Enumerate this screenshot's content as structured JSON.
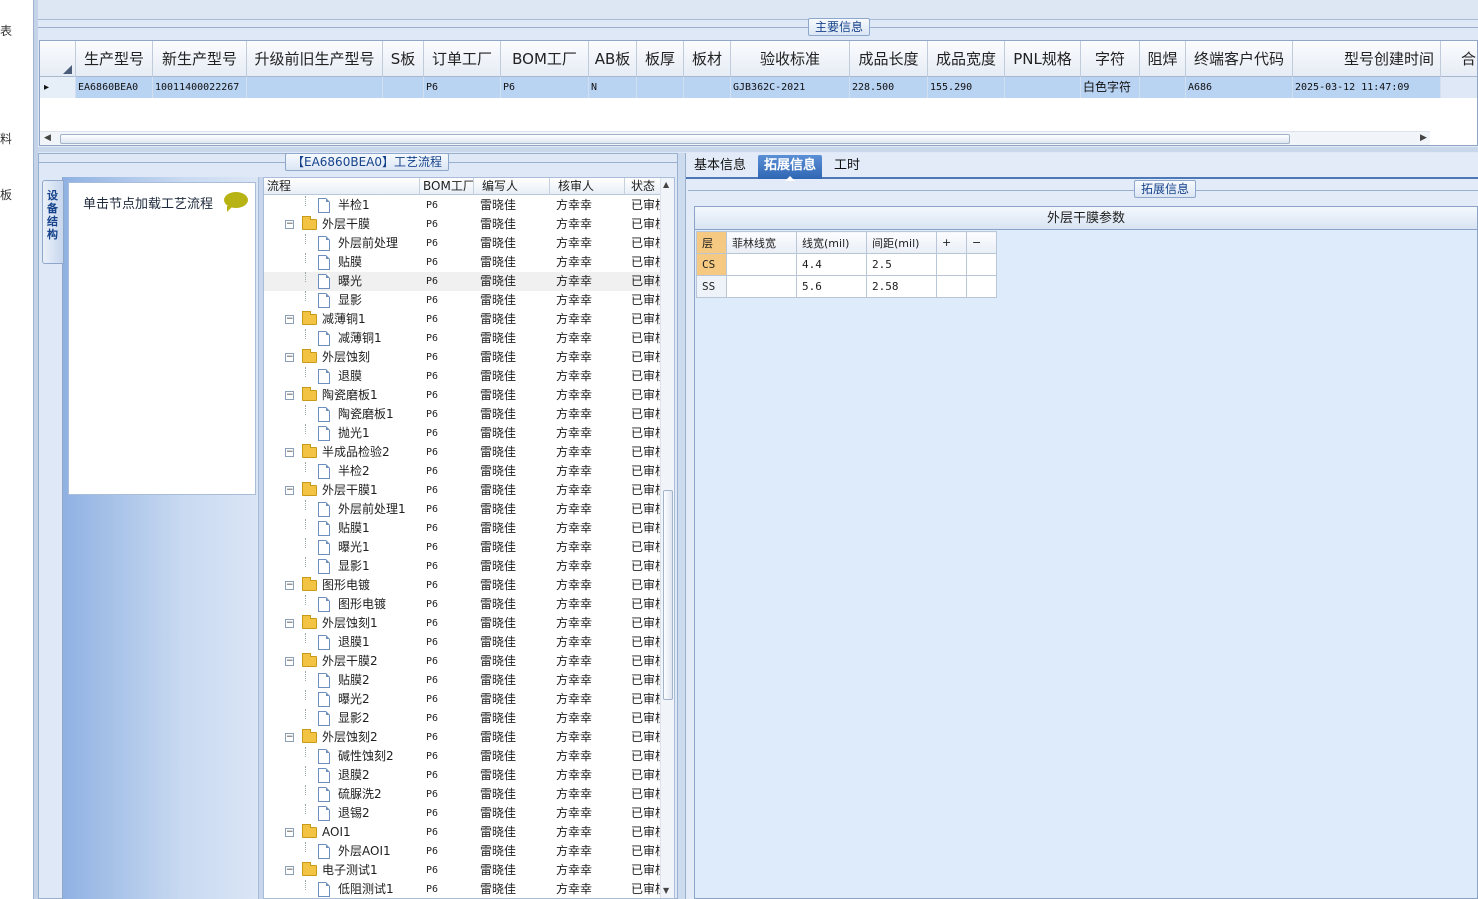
{
  "left_strip": {
    "glyphs": [
      "表",
      "料",
      "板"
    ]
  },
  "main_info": {
    "group_title": "主要信息",
    "columns": [
      "生产型号",
      "新生产型号",
      "升级前旧生产型号",
      "S板",
      "订单工厂",
      "BOM工厂",
      "AB板",
      "板厚",
      "板材",
      "验收标准",
      "成品长度",
      "成品宽度",
      "PNL规格",
      "字符",
      "阻焊",
      "终端客户代码",
      "型号创建时间",
      "合"
    ],
    "row": {
      "selector": "▸",
      "prod_model": "EA6860BEA0",
      "new_model": "10011400022267",
      "old_model": "",
      "s_board": "",
      "order_factory": "P6",
      "bom_factory": "P6",
      "ab_board": "N",
      "thickness": "",
      "material": "",
      "standard": "GJB362C-2021",
      "length": "228.500",
      "width": "155.290",
      "pnl": "",
      "char": "白色字符",
      "solder": "",
      "customer_code": "A686",
      "create_time": "2025-03-12 11:47:09"
    }
  },
  "process": {
    "group_title": "【EA6860BEA0】工艺流程",
    "side_tab": "设备结构",
    "hint": "单击节点加载工艺流程",
    "headers": [
      "流程",
      "BOM工厂",
      "编写人",
      "核审人",
      "状态"
    ],
    "rows": [
      {
        "name": "半检1",
        "level": 2,
        "type": "doc",
        "factory": "P6",
        "writer": "雷晓佳",
        "reviewer": "方幸幸",
        "status": "已审核"
      },
      {
        "name": "外层干膜",
        "level": 1,
        "type": "folder",
        "factory": "P6",
        "writer": "雷晓佳",
        "reviewer": "方幸幸",
        "status": "已审核"
      },
      {
        "name": "外层前处理",
        "level": 2,
        "type": "doc",
        "factory": "P6",
        "writer": "雷晓佳",
        "reviewer": "方幸幸",
        "status": "已审核"
      },
      {
        "name": "贴膜",
        "level": 2,
        "type": "doc",
        "factory": "P6",
        "writer": "雷晓佳",
        "reviewer": "方幸幸",
        "status": "已审核"
      },
      {
        "name": "曝光",
        "level": 2,
        "type": "doc",
        "factory": "P6",
        "writer": "雷晓佳",
        "reviewer": "方幸幸",
        "status": "已审核",
        "highlight": true
      },
      {
        "name": "显影",
        "level": 2,
        "type": "doc",
        "factory": "P6",
        "writer": "雷晓佳",
        "reviewer": "方幸幸",
        "status": "已审核"
      },
      {
        "name": "减薄铜1",
        "level": 1,
        "type": "folder",
        "factory": "P6",
        "writer": "雷晓佳",
        "reviewer": "方幸幸",
        "status": "已审核"
      },
      {
        "name": "减薄铜1",
        "level": 2,
        "type": "doc",
        "factory": "P6",
        "writer": "雷晓佳",
        "reviewer": "方幸幸",
        "status": "已审核"
      },
      {
        "name": "外层蚀刻",
        "level": 1,
        "type": "folder",
        "factory": "P6",
        "writer": "雷晓佳",
        "reviewer": "方幸幸",
        "status": "已审核"
      },
      {
        "name": "退膜",
        "level": 2,
        "type": "doc",
        "factory": "P6",
        "writer": "雷晓佳",
        "reviewer": "方幸幸",
        "status": "已审核"
      },
      {
        "name": "陶瓷磨板1",
        "level": 1,
        "type": "folder",
        "factory": "P6",
        "writer": "雷晓佳",
        "reviewer": "方幸幸",
        "status": "已审核"
      },
      {
        "name": "陶瓷磨板1",
        "level": 2,
        "type": "doc",
        "factory": "P6",
        "writer": "雷晓佳",
        "reviewer": "方幸幸",
        "status": "已审核"
      },
      {
        "name": "抛光1",
        "level": 2,
        "type": "doc",
        "factory": "P6",
        "writer": "雷晓佳",
        "reviewer": "方幸幸",
        "status": "已审核"
      },
      {
        "name": "半成品检验2",
        "level": 1,
        "type": "folder",
        "factory": "P6",
        "writer": "雷晓佳",
        "reviewer": "方幸幸",
        "status": "已审核"
      },
      {
        "name": "半检2",
        "level": 2,
        "type": "doc",
        "factory": "P6",
        "writer": "雷晓佳",
        "reviewer": "方幸幸",
        "status": "已审核"
      },
      {
        "name": "外层干膜1",
        "level": 1,
        "type": "folder",
        "factory": "P6",
        "writer": "雷晓佳",
        "reviewer": "方幸幸",
        "status": "已审核"
      },
      {
        "name": "外层前处理1",
        "level": 2,
        "type": "doc",
        "factory": "P6",
        "writer": "雷晓佳",
        "reviewer": "方幸幸",
        "status": "已审核"
      },
      {
        "name": "贴膜1",
        "level": 2,
        "type": "doc",
        "factory": "P6",
        "writer": "雷晓佳",
        "reviewer": "方幸幸",
        "status": "已审核"
      },
      {
        "name": "曝光1",
        "level": 2,
        "type": "doc",
        "factory": "P6",
        "writer": "雷晓佳",
        "reviewer": "方幸幸",
        "status": "已审核"
      },
      {
        "name": "显影1",
        "level": 2,
        "type": "doc",
        "factory": "P6",
        "writer": "雷晓佳",
        "reviewer": "方幸幸",
        "status": "已审核"
      },
      {
        "name": "图形电镀",
        "level": 1,
        "type": "folder",
        "factory": "P6",
        "writer": "雷晓佳",
        "reviewer": "方幸幸",
        "status": "已审核"
      },
      {
        "name": "图形电镀",
        "level": 2,
        "type": "doc",
        "factory": "P6",
        "writer": "雷晓佳",
        "reviewer": "方幸幸",
        "status": "已审核"
      },
      {
        "name": "外层蚀刻1",
        "level": 1,
        "type": "folder",
        "factory": "P6",
        "writer": "雷晓佳",
        "reviewer": "方幸幸",
        "status": "已审核"
      },
      {
        "name": "退膜1",
        "level": 2,
        "type": "doc",
        "factory": "P6",
        "writer": "雷晓佳",
        "reviewer": "方幸幸",
        "status": "已审核"
      },
      {
        "name": "外层干膜2",
        "level": 1,
        "type": "folder",
        "factory": "P6",
        "writer": "雷晓佳",
        "reviewer": "方幸幸",
        "status": "已审核"
      },
      {
        "name": "贴膜2",
        "level": 2,
        "type": "doc",
        "factory": "P6",
        "writer": "雷晓佳",
        "reviewer": "方幸幸",
        "status": "已审核"
      },
      {
        "name": "曝光2",
        "level": 2,
        "type": "doc",
        "factory": "P6",
        "writer": "雷晓佳",
        "reviewer": "方幸幸",
        "status": "已审核"
      },
      {
        "name": "显影2",
        "level": 2,
        "type": "doc",
        "factory": "P6",
        "writer": "雷晓佳",
        "reviewer": "方幸幸",
        "status": "已审核"
      },
      {
        "name": "外层蚀刻2",
        "level": 1,
        "type": "folder",
        "factory": "P6",
        "writer": "雷晓佳",
        "reviewer": "方幸幸",
        "status": "已审核"
      },
      {
        "name": "碱性蚀刻2",
        "level": 2,
        "type": "doc",
        "factory": "P6",
        "writer": "雷晓佳",
        "reviewer": "方幸幸",
        "status": "已审核"
      },
      {
        "name": "退膜2",
        "level": 2,
        "type": "doc",
        "factory": "P6",
        "writer": "雷晓佳",
        "reviewer": "方幸幸",
        "status": "已审核"
      },
      {
        "name": "硫脲洗2",
        "level": 2,
        "type": "doc",
        "factory": "P6",
        "writer": "雷晓佳",
        "reviewer": "方幸幸",
        "status": "已审核"
      },
      {
        "name": "退锡2",
        "level": 2,
        "type": "doc",
        "factory": "P6",
        "writer": "雷晓佳",
        "reviewer": "方幸幸",
        "status": "已审核"
      },
      {
        "name": "AOI1",
        "level": 1,
        "type": "folder",
        "factory": "P6",
        "writer": "雷晓佳",
        "reviewer": "方幸幸",
        "status": "已审核"
      },
      {
        "name": "外层AOI1",
        "level": 2,
        "type": "doc",
        "factory": "P6",
        "writer": "雷晓佳",
        "reviewer": "方幸幸",
        "status": "已审核"
      },
      {
        "name": "电子测试1",
        "level": 1,
        "type": "folder",
        "factory": "P6",
        "writer": "雷晓佳",
        "reviewer": "方幸幸",
        "status": "已审核"
      },
      {
        "name": "低阻测试1",
        "level": 2,
        "type": "doc",
        "factory": "P6",
        "writer": "雷晓佳",
        "reviewer": "方幸幸",
        "status": "已审核"
      }
    ]
  },
  "detail": {
    "tabs": [
      "基本信息",
      "拓展信息",
      "工时"
    ],
    "active_tab": 1,
    "group_title": "拓展信息",
    "param_title": "外层干膜参数",
    "param_headers": [
      "层",
      "菲林线宽",
      "线宽(mil)",
      "间距(mil)",
      "+",
      "−"
    ],
    "param_rows": [
      {
        "layer": "CS",
        "film": "",
        "width": "4.4",
        "spacing": "2.5"
      },
      {
        "layer": "SS",
        "film": "",
        "width": "5.6",
        "spacing": "2.58"
      }
    ]
  }
}
